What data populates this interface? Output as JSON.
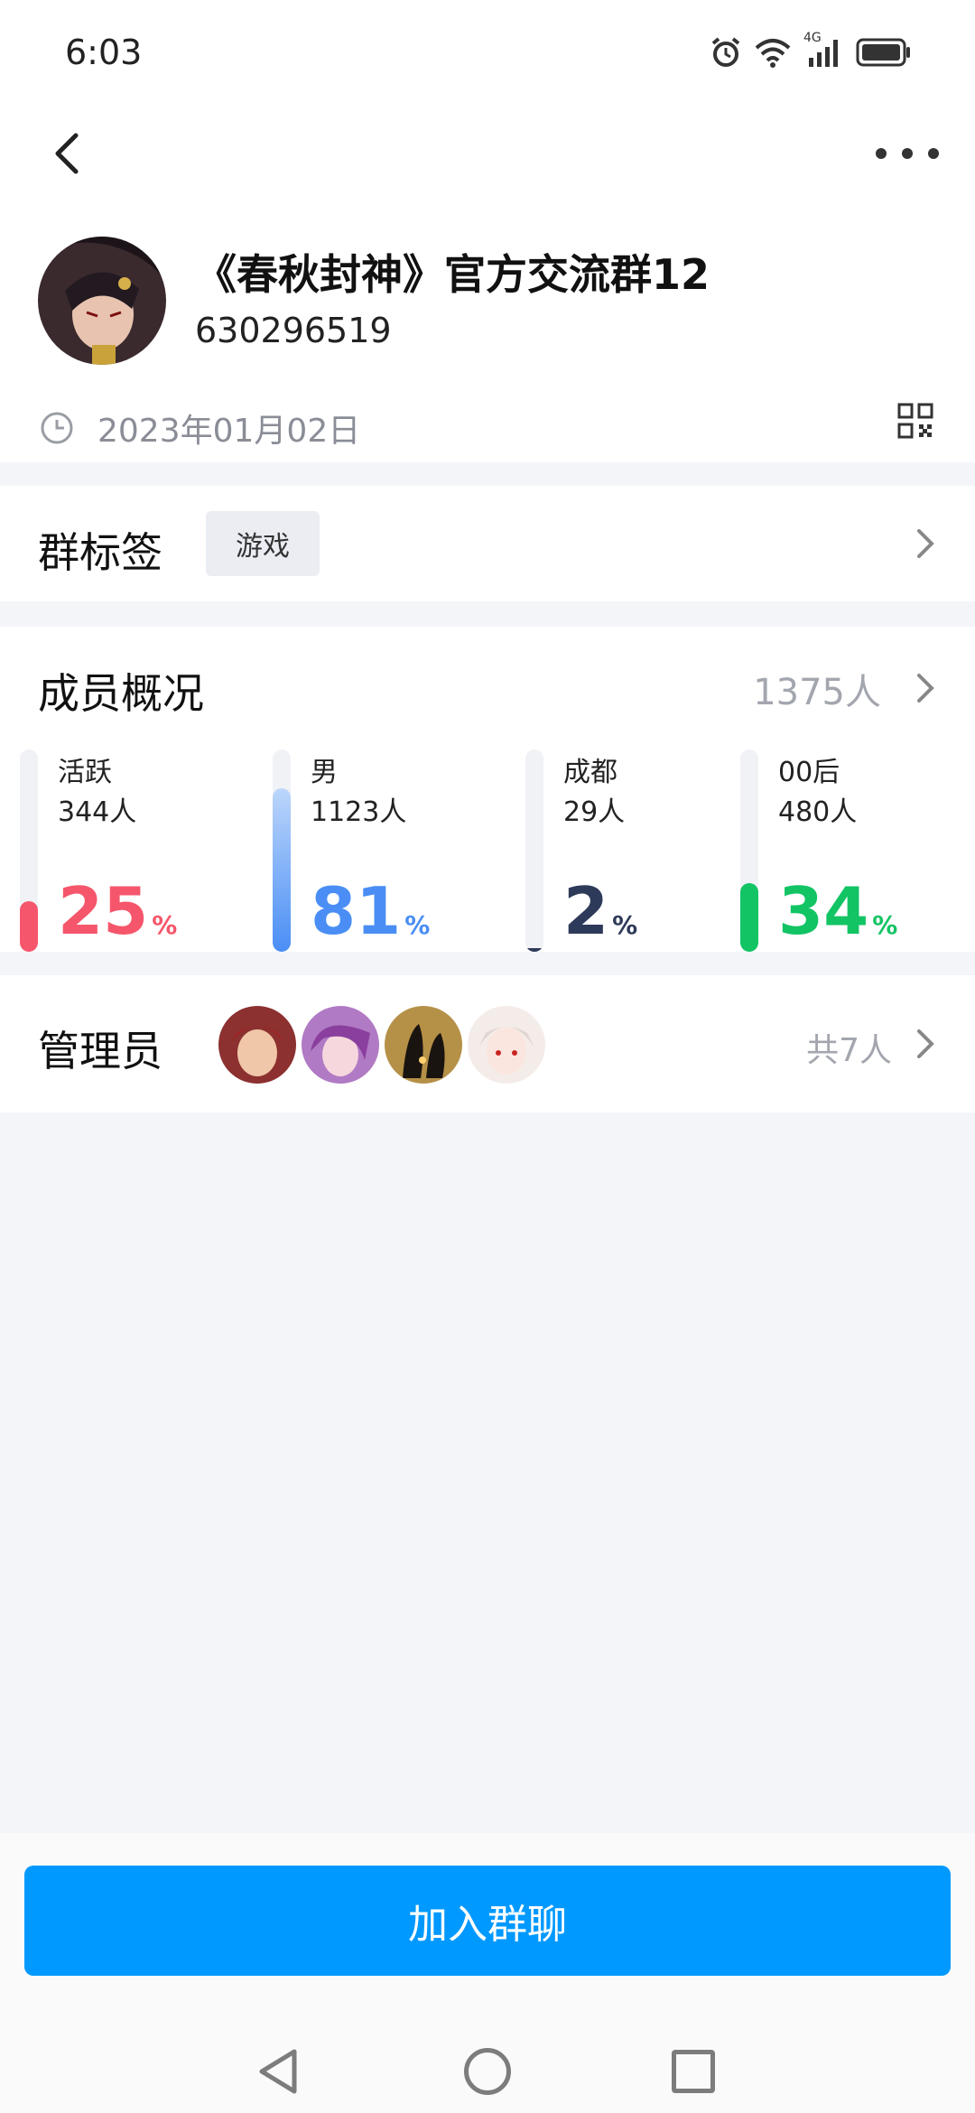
{
  "status_bar": {
    "time": "6:03",
    "network": "4G"
  },
  "group": {
    "name": "《春秋封神》官方交流群12",
    "id": "630296519",
    "created": "2023年01月02日"
  },
  "tags": {
    "title": "群标签",
    "tag": "游戏"
  },
  "members": {
    "title": "成员概况",
    "count": "1375人",
    "stats": [
      {
        "label": "活跃",
        "sub": "344人",
        "percent": "25",
        "fill": 25,
        "color": "#f5566b"
      },
      {
        "label": "男",
        "sub": "1123人",
        "percent": "81",
        "fill": 81,
        "color": "#4a8ef5"
      },
      {
        "label": "成都",
        "sub": "29人",
        "percent": "2",
        "fill": 2,
        "color": "#2e3a59"
      },
      {
        "label": "00后",
        "sub": "480人",
        "percent": "34",
        "fill": 34,
        "color": "#12c464"
      }
    ],
    "percent_sign": "%"
  },
  "admins": {
    "title": "管理员",
    "total": "共7人"
  },
  "join_button": "加入群聊"
}
